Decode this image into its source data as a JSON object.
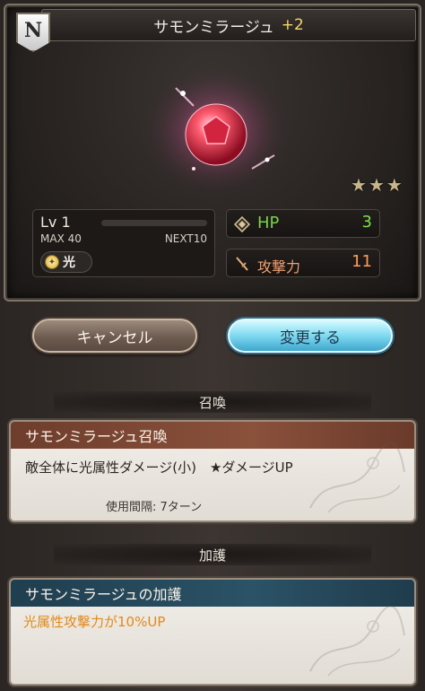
{
  "header": {
    "rarity_letter": "N",
    "title": "サモンミラージュ",
    "plus": "+2"
  },
  "summon": {
    "stars": 3,
    "level_label": "Lv 1",
    "max_label": "MAX 40",
    "next_label": "NEXT10",
    "element": {
      "icon": "light-element-icon",
      "label": "光"
    }
  },
  "stats": {
    "hp": {
      "label": "HP",
      "value": "3",
      "icon": "diamond-icon"
    },
    "atk": {
      "label": "攻撃力",
      "value": "11",
      "icon": "sword-icon"
    }
  },
  "buttons": {
    "cancel": "キャンセル",
    "change": "変更する"
  },
  "sections": {
    "summon_header": "召喚",
    "aura_header": "加護"
  },
  "summon_skill": {
    "title": "サモンミラージュ召喚",
    "description": "敵全体に光属性ダメージ(小)　★ダメージUP",
    "cooldown": "使用間隔: 7ターン"
  },
  "aura_skill": {
    "title": "サモンミラージュの加護",
    "description": "光属性攻撃力が10%UP"
  },
  "colors": {
    "summon_card_header": "#7a4533",
    "aura_card_header": "#244657",
    "hp_green": "#78d24a",
    "atk_orange": "#ff9a5a",
    "aura_text": "#e28a19"
  }
}
